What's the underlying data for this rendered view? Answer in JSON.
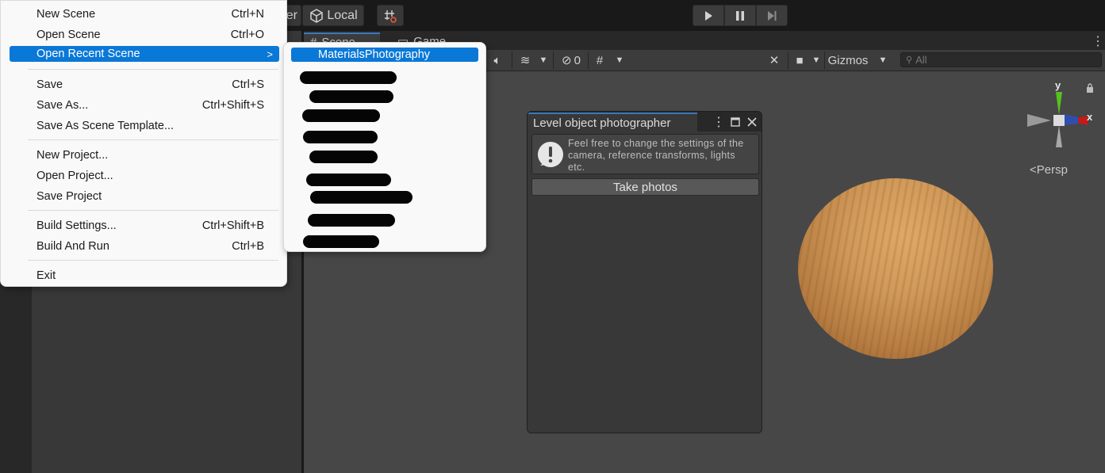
{
  "toolbar": {
    "pivot_partial": "er",
    "space_label": "Local"
  },
  "scene_tabs": {
    "scene": "Scene",
    "game": "Game"
  },
  "scene_toolbar": {
    "hidden_count": "0",
    "gizmos_label": "Gizmos",
    "search_placeholder": "All"
  },
  "gizmo": {
    "y_label": "y",
    "x_label": "x",
    "projection_label": "Persp"
  },
  "photographer_window": {
    "title": "Level object photographer",
    "help_text": "Feel free to change the settings of the camera, reference transforms, lights etc.",
    "button_label": "Take photos"
  },
  "file_menu": {
    "items": [
      {
        "label": "New Scene",
        "shortcut": "Ctrl+N"
      },
      {
        "label": "Open Scene",
        "shortcut": "Ctrl+O"
      },
      {
        "label": "Open Recent Scene",
        "shortcut": ">"
      },
      {
        "label": "Save",
        "shortcut": "Ctrl+S"
      },
      {
        "label": "Save As...",
        "shortcut": "Ctrl+Shift+S"
      },
      {
        "label": "Save As Scene Template...",
        "shortcut": ""
      },
      {
        "label": "New Project...",
        "shortcut": ""
      },
      {
        "label": "Open Project...",
        "shortcut": ""
      },
      {
        "label": "Save Project",
        "shortcut": ""
      },
      {
        "label": "Build Settings...",
        "shortcut": "Ctrl+Shift+B"
      },
      {
        "label": "Build And Run",
        "shortcut": "Ctrl+B"
      },
      {
        "label": "Exit",
        "shortcut": ""
      }
    ]
  },
  "recent_menu": {
    "first_item": "MaterialsPhotography"
  },
  "colors": {
    "menu_highlight": "#0a78d7",
    "editor_dark": "#191919",
    "viewport": "#474747",
    "sphere": "#d19a5a"
  }
}
